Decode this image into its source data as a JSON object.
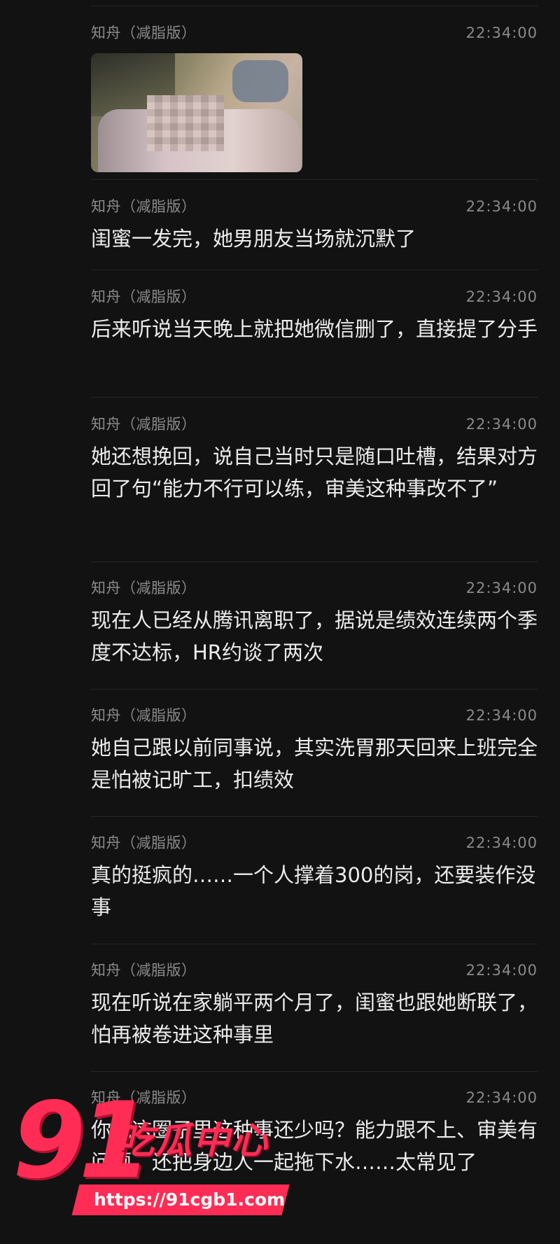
{
  "messages": [
    {
      "sender": "知舟（减脂版）",
      "time": "22:34:00",
      "type": "image",
      "image_alt": "blurred photo"
    },
    {
      "sender": "知舟（减脂版）",
      "time": "22:34:00",
      "text": "闺蜜一发完，她男朋友当场就沉默了"
    },
    {
      "sender": "知舟（减脂版）",
      "time": "22:34:00",
      "text": "后来听说当天晚上就把她微信删了，直接提了分手"
    },
    {
      "sender": "知舟（减脂版）",
      "time": "22:34:00",
      "text": "她还想挽回，说自己当时只是随口吐槽，结果对方回了句“能力不行可以练，审美这种事改不了”"
    },
    {
      "sender": "知舟（减脂版）",
      "time": "22:34:00",
      "text": "现在人已经从腾讯离职了，据说是绩效连续两个季度不达标，HR约谈了两次"
    },
    {
      "sender": "知舟（减脂版）",
      "time": "22:34:00",
      "text": "她自己跟以前同事说，其实洗胃那天回来上班完全是怕被记旷工，扣绩效"
    },
    {
      "sender": "知舟（减脂版）",
      "time": "22:34:00",
      "text": "真的挺疯的……一个人撑着300的岗，还要装作没事"
    },
    {
      "sender": "知舟（减脂版）",
      "time": "22:34:00",
      "text": "现在听说在家躺平两个月了，闺蜜也跟她断联了，怕再被卷进这种事里"
    },
    {
      "sender": "知舟（减脂版）",
      "time": "22:34:00",
      "text": "你说这圈子里这种事还少吗？能力跟不上、审美有问题，还把身边人一起拖下水……太常见了"
    }
  ],
  "watermark": {
    "number": "91",
    "brand": "吃瓜中心",
    "url": "https://91cgb1.com"
  }
}
